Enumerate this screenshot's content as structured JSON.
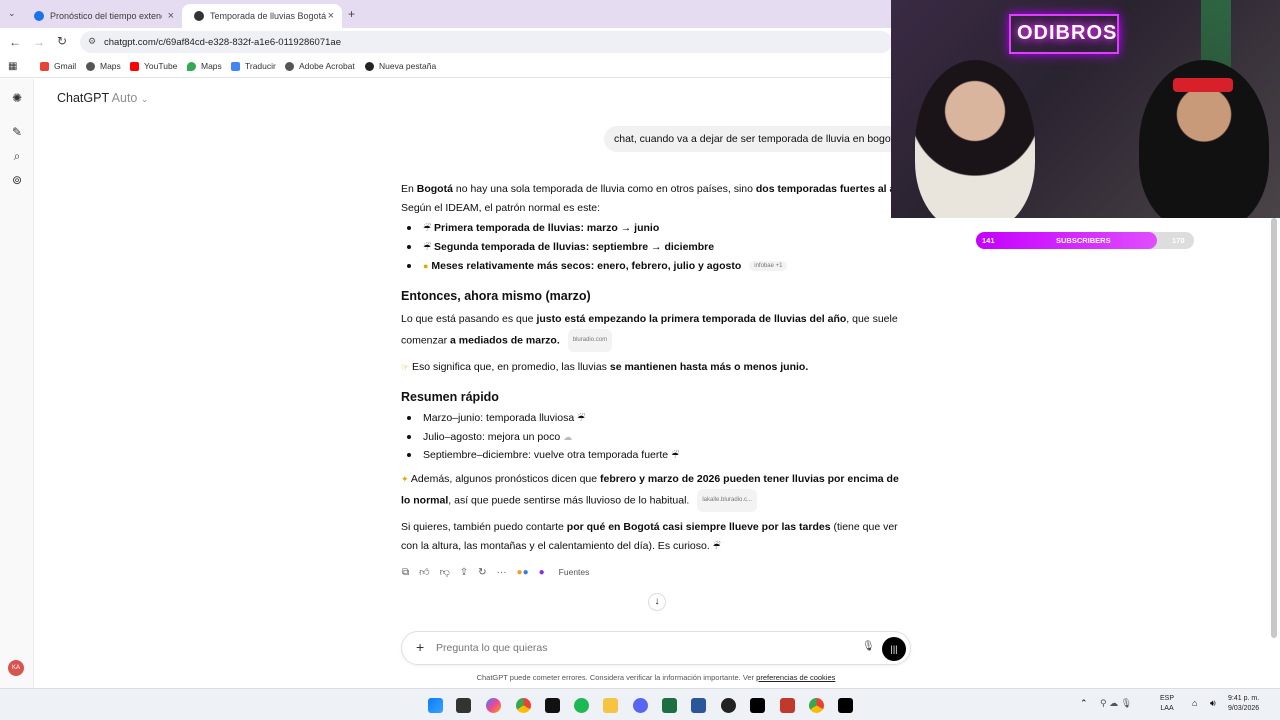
{
  "browser": {
    "tabs": [
      {
        "label": "Pronóstico del tiempo extendido",
        "active": false
      },
      {
        "label": "Temporada de lluvias Bogotá",
        "active": true
      }
    ],
    "new_tab": "+",
    "url": "chatgpt.com/c/69af84cd-e328-832f-a1e6-0119286071ae",
    "bookmarks": [
      "Gmail",
      "Maps",
      "YouTube",
      "Maps",
      "Traducir",
      "Adobe Acrobat",
      "Nueva pestaña"
    ]
  },
  "app": {
    "model_name": "ChatGPT",
    "model_mode": "Auto",
    "avatar_initials": "KA"
  },
  "chat": {
    "user_message": "chat, cuando va a dejar de ser temporada de lluvia en bogotá",
    "intro_a": "En ",
    "intro_b": "Bogotá",
    "intro_c": " no hay una sola temporada de lluvia como en otros países, sino ",
    "intro_d": "dos temporadas fuertes al año",
    "intro_e": "Según el IDEAM, el patrón normal es este:",
    "bullets1": [
      "Primera temporada de lluvias: marzo → junio",
      "Segunda temporada de lluvias: septiembre → diciembre",
      "Meses relativamente más secos: enero, febrero, julio y agosto"
    ],
    "chip_infobae": "infobae +1",
    "heading1": "Entonces, ahora mismo (marzo)",
    "p2_a": "Lo que está pasando es que ",
    "p2_b": "justo está empezando la primera temporada de lluvias del año",
    "p2_c": ", que suele comenzar ",
    "p2_d": "a mediados de marzo.",
    "chip_bluradio": "bluradio.com",
    "p3_a": "Eso significa que, en promedio, las lluvias ",
    "p3_b": "se mantienen hasta más o menos junio.",
    "heading2": "Resumen rápido",
    "bullets2": [
      "Marzo–junio: temporada lluviosa",
      "Julio–agosto: mejora un poco",
      "Septiembre–diciembre: vuelve otra temporada fuerte"
    ],
    "p4_a": "Además, algunos pronósticos dicen que ",
    "p4_b": "febrero y marzo de 2026 pueden tener lluvias por encima de lo normal",
    "p4_c": ", así que puede sentirse más lluvioso de lo habitual.",
    "chip_lakalle": "lakalle.bluradio.c...",
    "p5_a": "Si quieres, también puedo contarte ",
    "p5_b": "por qué en Bogotá casi siempre llueve por las tardes",
    "p5_c": " (tiene que ver con la altura, las montañas y el calentamiento del día). Es curioso.",
    "sources_label": "Fuentes"
  },
  "composer": {
    "placeholder": "Pregunta lo que quieras",
    "disclaimer": "ChatGPT puede cometer errores. Considera verificar la información importante. Ver ",
    "disclaimer_link": "preferencias de cookies"
  },
  "stream": {
    "neon_sign": "ODIBROS",
    "subscribers_label": "SUBSCRIBERS",
    "sub_current": "141",
    "sub_goal": "170",
    "sub_progress": 0.83
  },
  "taskbar": {
    "lang": "ESP",
    "region": "LAA",
    "time": "9:41 p. m.",
    "date": "9/03/2026"
  }
}
